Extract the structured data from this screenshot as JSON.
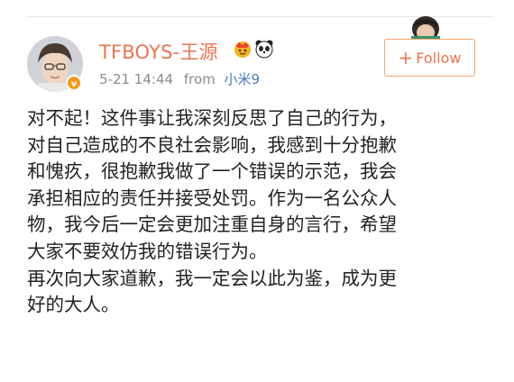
{
  "user": {
    "name": "TFBOYS-王源",
    "time": "5-21 14:44",
    "from_label": "from",
    "source": "小米9"
  },
  "follow_label": "Follow",
  "post_lines": [
    "对不起！这件事让我深刻反思了自己的行为，",
    "对自己造成的不良社会影响，我感到十分抱歉",
    "和愧疚，很抱歉我做了一个错误的示范，我会",
    "承担相应的责任并接受处罚。作为一名公众人",
    "物，我今后一定会更加注重自身的言行，希望",
    "大家不要效仿我的错误行为。",
    "再次向大家道歉，我一定会以此为鉴，成为更",
    "好的大人。"
  ],
  "colors": {
    "username": "#eb7350",
    "source_link": "#4a7dbb",
    "follow_border": "#f5a46d",
    "verified_badge": "#f49a19"
  },
  "icons": [
    "avatar-photo",
    "verified-badge-icon",
    "crown-icon",
    "panda-icon",
    "plus-icon"
  ]
}
